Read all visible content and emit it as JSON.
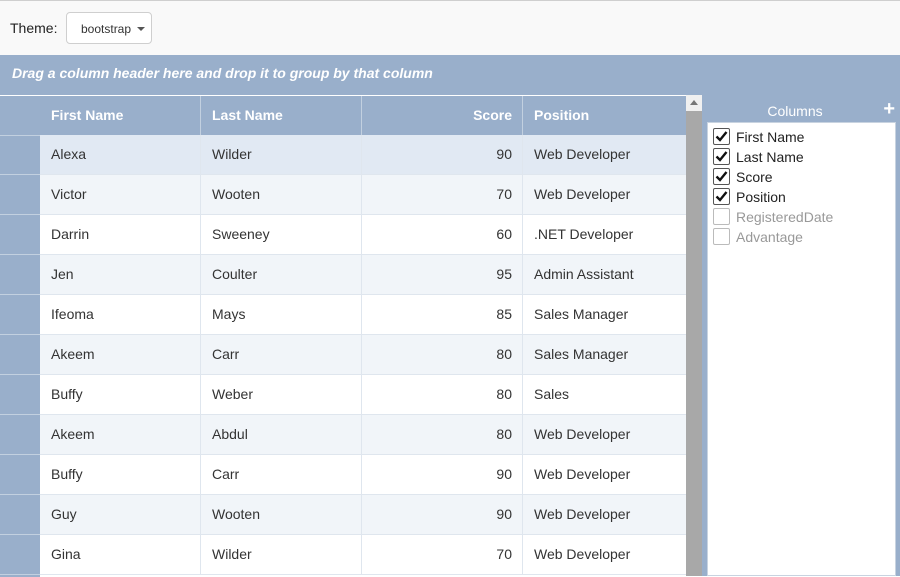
{
  "theme": {
    "label": "Theme:",
    "value": "bootstrap"
  },
  "groupbar": {
    "text": "Drag a column header here and drop it to group by that column"
  },
  "grid": {
    "headers": [
      "First Name",
      "Last Name",
      "Score",
      "Position"
    ],
    "rows": [
      [
        "Alexa",
        "Wilder",
        "90",
        "Web Developer"
      ],
      [
        "Victor",
        "Wooten",
        "70",
        "Web Developer"
      ],
      [
        "Darrin",
        "Sweeney",
        "60",
        ".NET Developer"
      ],
      [
        "Jen",
        "Coulter",
        "95",
        "Admin Assistant"
      ],
      [
        "Ifeoma",
        "Mays",
        "85",
        "Sales Manager"
      ],
      [
        "Akeem",
        "Carr",
        "80",
        "Sales Manager"
      ],
      [
        "Buffy",
        "Weber",
        "80",
        "Sales"
      ],
      [
        "Akeem",
        "Abdul",
        "80",
        "Web Developer"
      ],
      [
        "Buffy",
        "Carr",
        "90",
        "Web Developer"
      ],
      [
        "Guy",
        "Wooten",
        "90",
        "Web Developer"
      ],
      [
        "Gina",
        "Wilder",
        "70",
        "Web Developer"
      ]
    ]
  },
  "columns_panel": {
    "title": "Columns",
    "add_icon": "plus-icon",
    "items": [
      {
        "label": "First Name",
        "checked": true
      },
      {
        "label": "Last Name",
        "checked": true
      },
      {
        "label": "Score",
        "checked": true
      },
      {
        "label": "Position",
        "checked": true
      },
      {
        "label": "RegisteredDate",
        "checked": false
      },
      {
        "label": "Advantage",
        "checked": false
      }
    ]
  },
  "colors": {
    "header_bg": "#99afcb",
    "selected_row": "#e1e9f3",
    "alt_row": "#f1f5f9"
  }
}
